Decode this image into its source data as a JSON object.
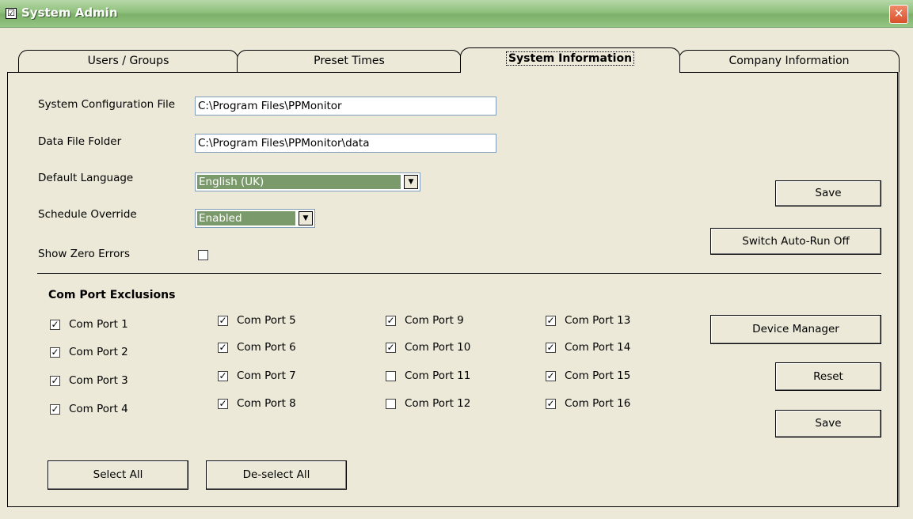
{
  "window": {
    "title": "System Admin",
    "close_symbol": "✕",
    "title_icon_symbol": "☑"
  },
  "tabs": [
    "Users / Groups",
    "Preset Times",
    "System Information",
    "Company Information"
  ],
  "form": {
    "config_file_label": "System Configuration File",
    "config_file_value": "C:\\Program Files\\PPMonitor",
    "data_folder_label": "Data File Folder",
    "data_folder_value": "C:\\Program Files\\PPMonitor\\data",
    "language_label": "Default Language",
    "language_value": "English (UK)",
    "schedule_label": "Schedule Override",
    "schedule_value": "Enabled",
    "zero_errors_label": "Show Zero Errors",
    "zero_errors_checked": false
  },
  "buttons": {
    "save_top": "Save",
    "switch_autorun": "Switch Auto-Run Off",
    "device_manager": "Device Manager",
    "reset": "Reset",
    "save_bottom": "Save",
    "select_all": "Select All",
    "deselect_all": "De-select All"
  },
  "com_ports": {
    "title": "Com Port Exclusions",
    "check_symbol": "✓",
    "dropdown_arrow": "▼",
    "ports": [
      {
        "label": "Com Port 1",
        "checked": true
      },
      {
        "label": "Com Port 2",
        "checked": true
      },
      {
        "label": "Com Port 3",
        "checked": true
      },
      {
        "label": "Com Port 4",
        "checked": true
      },
      {
        "label": "Com Port 5",
        "checked": true
      },
      {
        "label": "Com Port 6",
        "checked": true
      },
      {
        "label": "Com Port 7",
        "checked": true
      },
      {
        "label": "Com Port 8",
        "checked": true
      },
      {
        "label": "Com Port 9",
        "checked": true
      },
      {
        "label": "Com Port 10",
        "checked": true
      },
      {
        "label": "Com Port 11",
        "checked": false
      },
      {
        "label": "Com Port 12",
        "checked": false
      },
      {
        "label": "Com Port 13",
        "checked": true
      },
      {
        "label": "Com Port 14",
        "checked": true
      },
      {
        "label": "Com Port 15",
        "checked": true
      },
      {
        "label": "Com Port 16",
        "checked": true
      }
    ]
  }
}
